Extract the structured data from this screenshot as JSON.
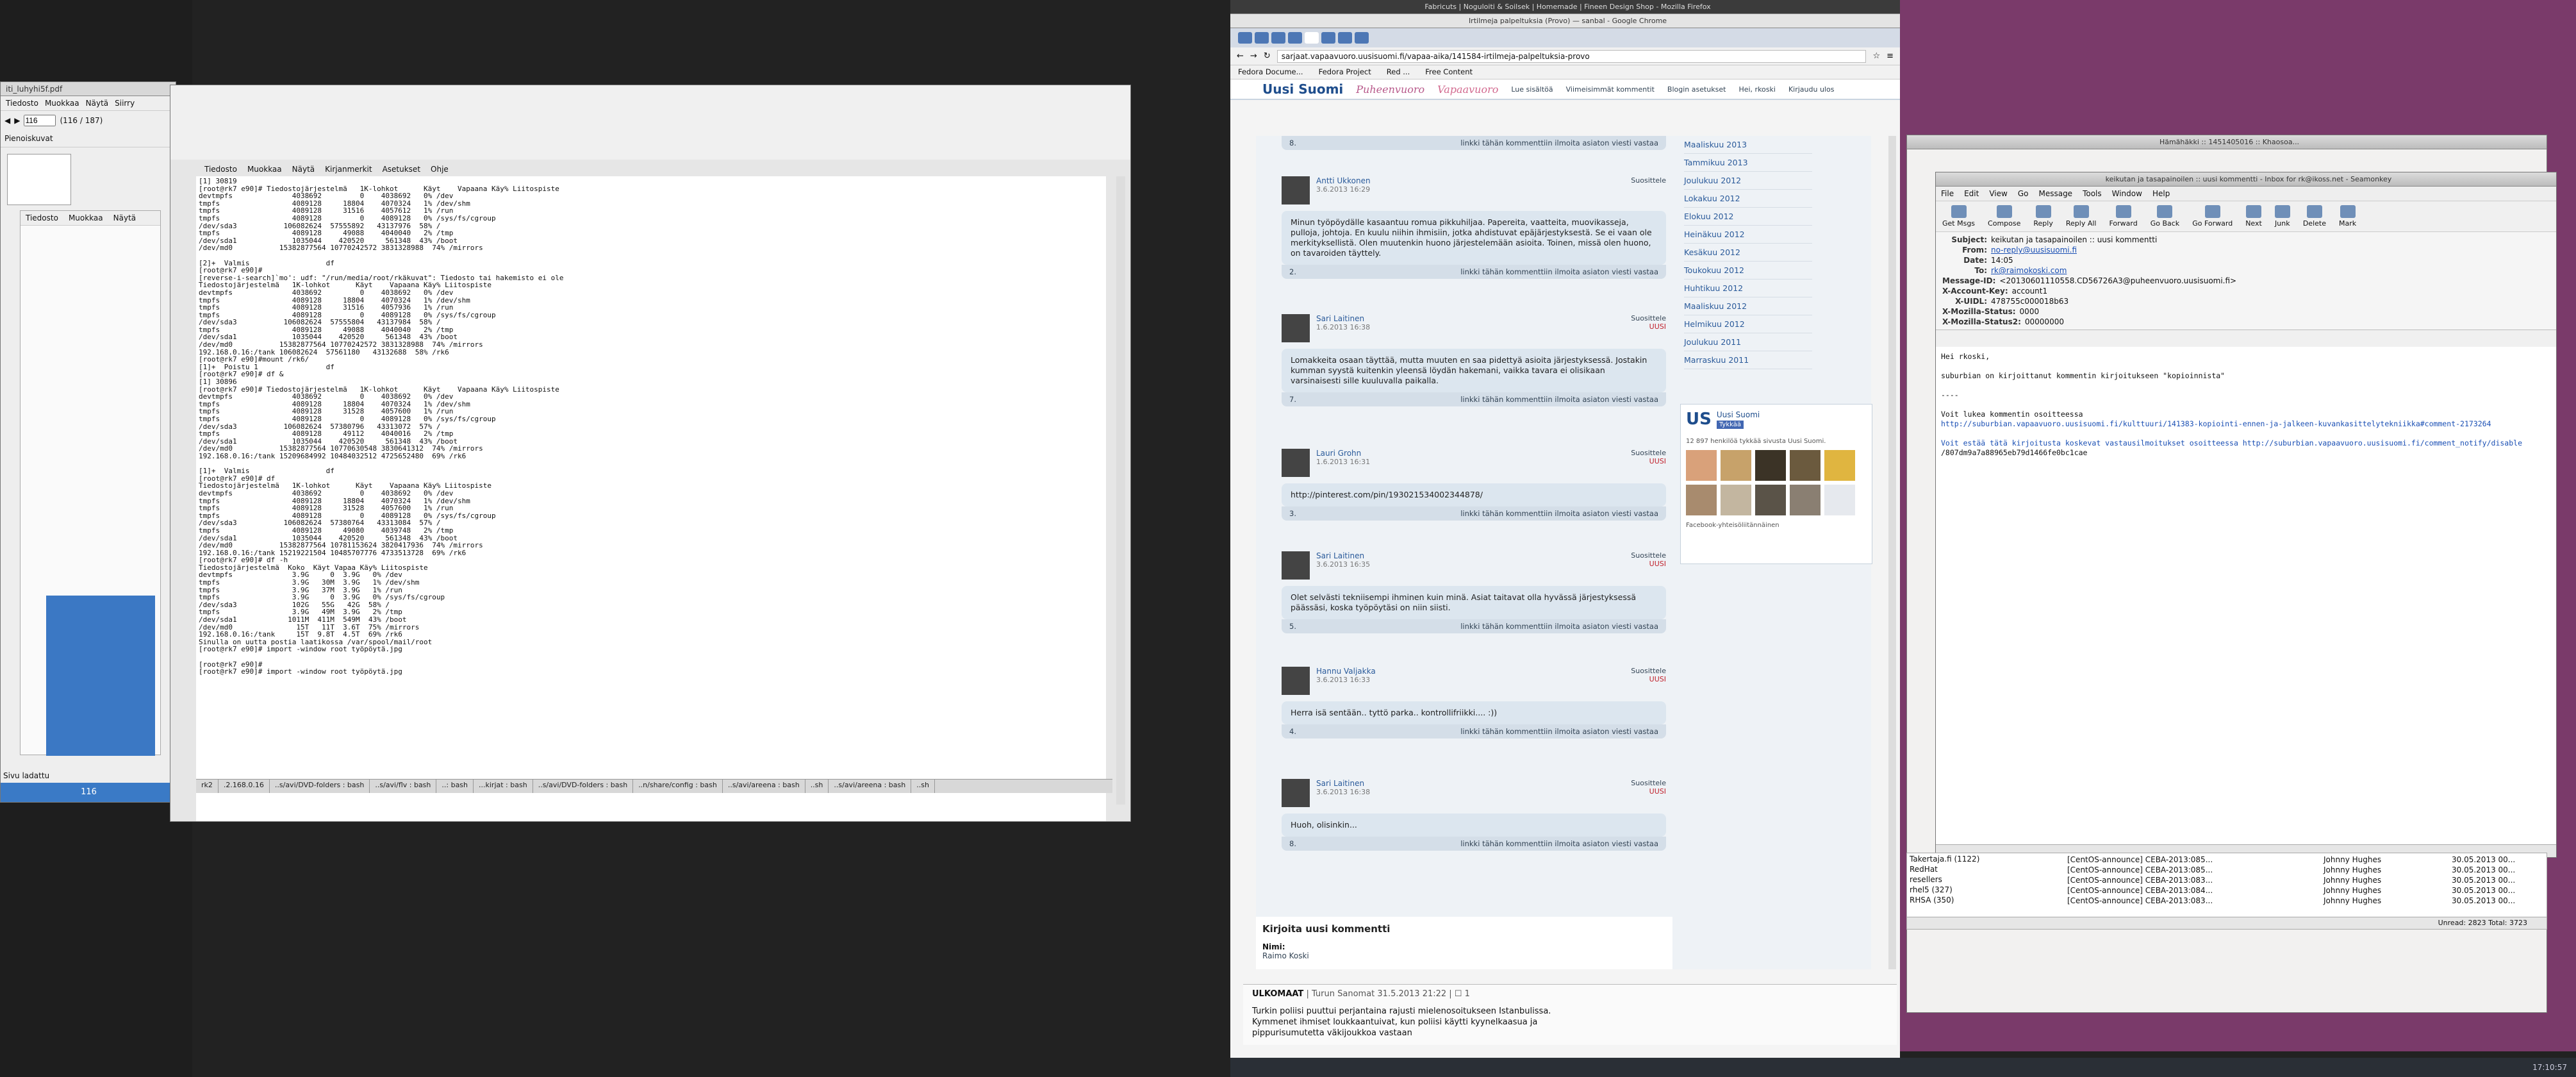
{
  "desktop": {
    "bg_color": "#1a1a1a"
  },
  "left_panel": {
    "pdf_title": "iti_luhyhi5f.pdf",
    "menu": [
      "Tiedosto",
      "Muokkaa",
      "Näytä",
      "Siirry",
      "Kirjanmerkit",
      "Ohje"
    ],
    "page_input": "116",
    "page_count": "(116 / 187)",
    "sidebar_label": "Pienoiskuvat",
    "status": "Sivu ladattu",
    "page_number": "116",
    "small_menu": [
      "Tiedosto",
      "Muokkaa",
      "Näytä"
    ]
  },
  "terminal": {
    "menu": [
      "Tiedosto",
      "Muokkaa",
      "Näytä",
      "Kirjanmerkit",
      "Asetukset",
      "Ohje"
    ],
    "lines": [
      "[1] 30819",
      "[root@rk7 e90]# Tiedostojärjestelmä   1K-lohkot      Käyt    Vapaana Käy% Liitospiste",
      "devtmpfs              4038692         0    4038692   0% /dev",
      "tmpfs                 4089128     18804    4070324   1% /dev/shm",
      "tmpfs                 4089128     31516    4057612   1% /run",
      "tmpfs                 4089128         0    4089128   0% /sys/fs/cgroup",
      "/dev/sda3           106082624  57555892   43137976  58% /",
      "tmpfs                 4089128     49088    4040040   2% /tmp",
      "/dev/sda1             1035044    420520     561348  43% /boot",
      "/dev/md0           15382877564 10770242572 3831328988  74% /mirrors",
      "",
      "[2]+  Valmis                  df",
      "[root@rk7 e90]# ",
      "[reverse-i-search]`mo': udf: \"/run/media/root/rkäkuvat\": Tiedosto tai hakemisto ei ole",
      "Tiedostojärjestelmä   1K-lohkot      Käyt    Vapaana Käy% Liitospiste",
      "devtmpfs              4038692         0    4038692   0% /dev",
      "tmpfs                 4089128     18804    4070324   1% /dev/shm",
      "tmpfs                 4089128     31516    4057936   1% /run",
      "tmpfs                 4089128         0    4089128   0% /sys/fs/cgroup",
      "/dev/sda3           106082624  57555804   43137984  58% /",
      "tmpfs                 4089128     49088    4040040   2% /tmp",
      "/dev/sda1             1035044    420520     561348  43% /boot",
      "/dev/md0           15382877564 10770242572 3831328988  74% /mirrors",
      "192.168.0.16:/tank 106082624  57561180   43132688  58% /rk6",
      "[root@rk7 e90]#mount /rk6/",
      "[1]+  Poistu 1                df",
      "[root@rk7 e90]# df &",
      "[1] 30896",
      "[root@rk7 e90]# Tiedostojärjestelmä   1K-lohkot      Käyt    Vapaana Käy% Liitospiste",
      "devtmpfs              4038692         0    4038692   0% /dev",
      "tmpfs                 4089128     18804    4070324   1% /dev/shm",
      "tmpfs                 4089128     31528    4057600   1% /run",
      "tmpfs                 4089128         0    4089128   0% /sys/fs/cgroup",
      "/dev/sda3           106082624  57380796   43313072  57% /",
      "tmpfs                 4089128     49112    4040016   2% /tmp",
      "/dev/sda1             1035044    420520     561348  43% /boot",
      "/dev/md0           15382877564 10770630548 3830641312  74% /mirrors",
      "192.168.0.16:/tank 15209684992 10484032512 4725652480  69% /rk6",
      "",
      "[1]+  Valmis                  df",
      "[root@rk7 e90]# df",
      "Tiedostojärjestelmä   1K-lohkot      Käyt    Vapaana Käy% Liitospiste",
      "devtmpfs              4038692         0    4038692   0% /dev",
      "tmpfs                 4089128     18804    4070324   1% /dev/shm",
      "tmpfs                 4089128     31528    4057600   1% /run",
      "tmpfs                 4089128         0    4089128   0% /sys/fs/cgroup",
      "/dev/sda3           106082624  57380764   43313084  57% /",
      "tmpfs                 4089128     49080    4039748   2% /tmp",
      "/dev/sda1             1035044    420520     561348  43% /boot",
      "/dev/md0           15382877564 10781153624 3820417936  74% /mirrors",
      "192.168.0.16:/tank 15219221504 10485707776 4733513728  69% /rk6",
      "[root@rk7 e90]# df -h",
      "Tiedostojärjestelmä  Koko  Käyt Vapaa Käy% Liitospiste",
      "devtmpfs              3.9G     0  3.9G   0% /dev",
      "tmpfs                 3.9G   30M  3.9G   1% /dev/shm",
      "tmpfs                 3.9G   37M  3.9G   1% /run",
      "tmpfs                 3.9G     0  3.9G   0% /sys/fs/cgroup",
      "/dev/sda3             102G   55G   42G  58% /",
      "tmpfs                 3.9G   49M  3.9G   2% /tmp",
      "/dev/sda1            1011M  411M  549M  43% /boot",
      "/dev/md0               15T   11T  3.6T  75% /mirrors",
      "192.168.0.16:/tank     15T  9.8T  4.5T  69% /rk6",
      "Sinulla on uutta postia laatikossa /var/spool/mail/root",
      "[root@rk7 e90]# import -window root työpöytä.jpg",
      "",
      "[root@rk7 e90]#",
      "[root@rk7 e90]# import -window root työpöytä.jpg"
    ],
    "tabs": [
      "rk2",
      ".2.168.0.16",
      "..s/avi/DVD-folders : bash",
      "..s/avi/flv : bash",
      "..: bash",
      "...kirjat : bash",
      "..s/avi/DVD-folders : bash",
      "..n/share/config : bash",
      "..s/avi/areena : bash",
      "..sh",
      "..s/avi/areena : bash",
      "..sh"
    ]
  },
  "browser": {
    "titlebar": "Fabricuts | Noguloiti & Soilsek | Homemade | Fineen Design Shop - Mozilla Firefox",
    "chrome_title": "Irtilmeja palpeltuksia (Provo) — sanbal - Google Chrome",
    "url": "sarjaat.vapaavuoro.uusisuomi.fi/vapaa-aika/141584-irtilmeja-palpeltuksia-provo",
    "bookmarks": [
      "Fedora Docume...",
      "Fedora Project",
      "Red ...",
      "Free Content"
    ],
    "site": {
      "logo": "Uusi Suomi",
      "logo2": "Puheenvuoro",
      "logo3": "Vapaavuoro",
      "nav": [
        "Lue sisältöä",
        "Viimeisimmät kommentit",
        "Blogin asetukset",
        "Hei, rkoski",
        "Kirjaudu ulos"
      ]
    },
    "comments": [
      {
        "author": "",
        "date": "",
        "text": "",
        "num": "8.",
        "actions": "linkki tähän kommenttiin  ilmoita asiaton viesti  vastaa"
      },
      {
        "author": "Antti Ukkonen",
        "date": "3.6.2013 16:29",
        "rec": "Suosittele",
        "new": "",
        "text": "Minun työpöydälle kasaantuu romua pikkuhiljaa. Papereita, vaatteita, muovikasseja, pulloja, johtoja. En kuulu niihin ihmisiin, jotka ahdistuvat epäjärjestyksestä. Se ei vaan ole merkityksellistä. Olen muutenkin huono järjestelemään asioita. Toinen, missä olen huono, on tavaroiden täyttely.",
        "num": "2.",
        "actions": "linkki tähän kommenttiin  ilmoita asiaton viesti  vastaa"
      },
      {
        "author": "Sari Laitinen",
        "date": "1.6.2013 16:38",
        "rec": "Suosittele",
        "new": "UUSI",
        "text": "Lomakkeita osaan täyttää, mutta muuten en saa pidettyä asioita järjestyksessä. Jostakin kumman syystä kuitenkin yleensä löydän hakemani, vaikka tavara ei olisikaan varsinaisesti sille kuuluvalla paikalla.",
        "num": "7.",
        "actions": "linkki tähän kommenttiin  ilmoita asiaton viesti  vastaa"
      },
      {
        "author": "Lauri Grohn",
        "date": "1.6.2013 16:31",
        "rec": "Suosittele",
        "new": "UUSI",
        "text": "http://pinterest.com/pin/193021534002344878/",
        "num": "3.",
        "actions": "linkki tähän kommenttiin  ilmoita asiaton viesti  vastaa"
      },
      {
        "author": "Sari Laitinen",
        "date": "3.6.2013 16:35",
        "rec": "Suosittele",
        "new": "UUSI",
        "text": "Olet selvästi tekniisempi ihminen kuin minä. Asiat taitavat olla hyvässä järjestyksessä päässäsi, koska työpöytäsi on niin siisti.",
        "num": "5.",
        "actions": "linkki tähän kommenttiin  ilmoita asiaton viesti  vastaa"
      },
      {
        "author": "Hannu Valjakka",
        "date": "3.6.2013 16:33",
        "rec": "Suosittele",
        "new": "UUSI",
        "text": "Herra isä sentään.. tyttö parka.. kontrollifriikki.... :))",
        "num": "4.",
        "actions": "linkki tähän kommenttiin  ilmoita asiaton viesti  vastaa"
      },
      {
        "author": "Sari Laitinen",
        "date": "3.6.2013 16:38",
        "rec": "Suosittele",
        "new": "UUSI",
        "text": "Huoh, olisinkin...",
        "num": "8.",
        "actions": "linkki tähän kommenttiin  ilmoita asiaton viesti  vastaa"
      }
    ],
    "archive": [
      "Maaliskuu 2013",
      "Tammikuu 2013",
      "Joulukuu 2012",
      "Lokakuu 2012",
      "Elokuu 2012",
      "Heinäkuu 2012",
      "Kesäkuu 2012",
      "Toukokuu 2012",
      "Huhtikuu 2012",
      "Maaliskuu 2012",
      "Helmikuu 2012",
      "Joulukuu 2011",
      "Marraskuu 2011"
    ],
    "fb": {
      "title": "Uusi Suomi",
      "like": "Tykkää",
      "count_text": "12 897 henkilöä tykkää sivusta Uusi Suomi.",
      "plugin": "Facebook-yhteisöliitännäinen"
    },
    "new_comment": {
      "heading": "Kirjoita uusi kommentti",
      "name_label": "Nimi:",
      "name_value": "Raimo Koski"
    },
    "ticker": {
      "source": "ULKOMAAT",
      "meta": "| Turun Sanomat 31.5.2013 21:22 | ☐ 1",
      "text": "Turkin poliisi puuttui perjantaina rajusti mielenosoitukseen Istanbulissa. Kymmenet ihmiset loukkaantuivat, kun poliisi käytti kyynelkaasua ja pippurisumutetta väkijoukkoa vastaan"
    }
  },
  "mail": {
    "bg_title": "Hämähäkki :: 1451405016 :: Khaosoa...",
    "title": "keikutan ja tasapainoilen :: uusi kommentti - Inbox for rk@ikoss.net - Seamonkey",
    "menu": [
      "File",
      "Edit",
      "View",
      "Go",
      "Message",
      "Tools",
      "Window",
      "Help"
    ],
    "toolbar": [
      "Get Msgs",
      "Compose",
      "Reply",
      "Reply All",
      "Forward",
      "Go Back",
      "Go Forward",
      "Next",
      "Junk",
      "Delete",
      "Mark"
    ],
    "headers": [
      {
        "k": "Subject:",
        "v": "keikutan ja tasapainoilen :: uusi kommentti"
      },
      {
        "k": "From:",
        "v": "no-reply@uusisuomi.fi"
      },
      {
        "k": "Date:",
        "v": "14:05"
      },
      {
        "k": "To:",
        "v": "rk@raimokoski.com"
      },
      {
        "k": "Message-ID:",
        "v": "<20130601110558.CD56726A3@puheenvuoro.uusisuomi.fi>"
      },
      {
        "k": "X-Account-Key:",
        "v": "account1"
      },
      {
        "k": "X-UIDL:",
        "v": "478755c000018b63"
      },
      {
        "k": "X-Mozilla-Status:",
        "v": "0000"
      },
      {
        "k": "X-Mozilla-Status2:",
        "v": "00000000"
      }
    ],
    "body": [
      "Hei rkoski,",
      "",
      "suburbian on kirjoittanut kommentin kirjoitukseen \"kopioinnista\"",
      "",
      "----",
      "",
      "Voit lukea kommentin osoitteessa",
      "http://suburbian.vapaavuoro.uusisuomi.fi/kulttuuri/141383-kopiointi-ennen-ja-jalkeen-kuvankasittelytekniikka#comment-2173264",
      "",
      "Voit estää tätä kirjoitusta koskevat vastausilmoitukset osoitteessa http://suburbian.vapaavuoro.uusisuomi.fi/comment_notify/disable",
      "/807dm9a7a88965eb79d1466fe0bc1cae"
    ],
    "folders": [
      "Takertaja.fi (1122)",
      "RedHat",
      "resellers",
      "rhel5 (327)",
      "RHSA (350)"
    ],
    "messages": [
      {
        "s": "[CentOS-announce] CEBA-2013:085...",
        "f": "Johnny Hughes",
        "d": "30.05.2013 00..."
      },
      {
        "s": "[CentOS-announce] CEBA-2013:085...",
        "f": "Johnny Hughes",
        "d": "30.05.2013 00..."
      },
      {
        "s": "[CentOS-announce] CEBA-2013:083...",
        "f": "Johnny Hughes",
        "d": "30.05.2013 00..."
      },
      {
        "s": "[CentOS-announce] CEBA-2013:084...",
        "f": "Johnny Hughes",
        "d": "30.05.2013 00..."
      },
      {
        "s": "[CentOS-announce] CEBA-2013:083...",
        "f": "Johnny Hughes",
        "d": "30.05.2013 00..."
      }
    ],
    "status": "Unread: 2823     Total: 3723"
  },
  "taskbar": {
    "clock": "17:10:57"
  },
  "colors": {
    "accent": "#2a6fc9",
    "terminal_bg": "#ffffff",
    "site_blue": "#1e4d8c",
    "new_red": "#c0202a"
  }
}
